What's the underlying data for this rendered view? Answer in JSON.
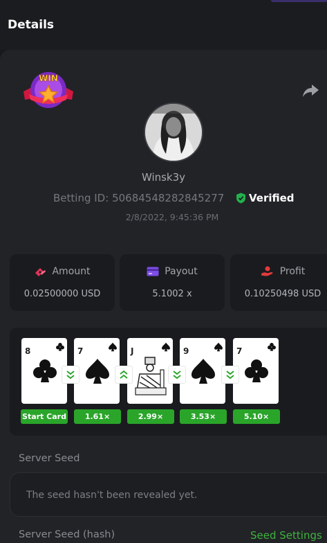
{
  "header": {
    "title": "Details"
  },
  "bet": {
    "username": "Winsk3y",
    "betting_id_label": "Betting ID:",
    "betting_id": "50684548282845277",
    "verified_label": "Verified",
    "date": "2/8/2022, 9:45:36 PM",
    "win_badge_text": "WIN"
  },
  "stats": [
    {
      "label": "Amount",
      "value": "0.02500000 USD",
      "icon": "money-hand-icon"
    },
    {
      "label": "Payout",
      "value": "5.1002 x",
      "icon": "credit-card-icon"
    },
    {
      "label": "Profit",
      "value": "0.10250498 USD",
      "icon": "profit-hand-icon"
    }
  ],
  "cards": [
    {
      "rank": "8",
      "suit": "clubs",
      "label": "Start Card"
    },
    {
      "rank": "7",
      "suit": "spades",
      "label": "1.61×"
    },
    {
      "rank": "J",
      "suit": "spades",
      "label": "2.99×"
    },
    {
      "rank": "9",
      "suit": "spades",
      "label": "3.53×"
    },
    {
      "rank": "7",
      "suit": "clubs",
      "label": "5.10×"
    }
  ],
  "guesses": [
    "lower",
    "higher",
    "lower",
    "lower"
  ],
  "server_seed": {
    "label": "Server Seed",
    "placeholder": "The seed hasn't been revealed yet.",
    "hash_label": "Server Seed (hash)",
    "settings_link": "Seed Settings"
  },
  "colors": {
    "accent_green": "#3db33d",
    "label_green": "#2aa52a",
    "panel": "#222327"
  }
}
